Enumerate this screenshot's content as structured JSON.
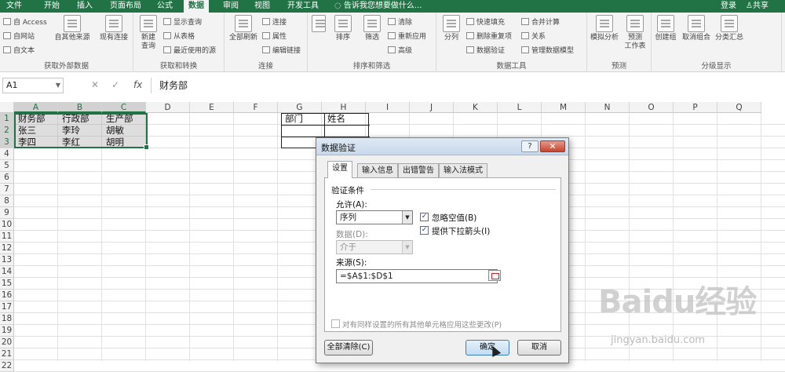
{
  "ribbon_tabs": [
    {
      "label": "文件"
    },
    {
      "label": "开始"
    },
    {
      "label": "插入"
    },
    {
      "label": "页面布局"
    },
    {
      "label": "公式"
    },
    {
      "label": "数据",
      "active": true
    },
    {
      "label": "审阅"
    },
    {
      "label": "视图"
    },
    {
      "label": "开发工具"
    }
  ],
  "tell_me": "告诉我您想要做什么...",
  "login": "登录",
  "share": "共享",
  "groups": {
    "external": {
      "label": "获取外部数据",
      "items": [
        "自 Access",
        "自网站",
        "自文本",
        "自其他来源",
        "现有连接"
      ]
    },
    "transform": {
      "label": "获取和转换",
      "items": [
        "新建",
        "查询",
        "显示查询",
        "从表格",
        "最近使用的源"
      ]
    },
    "connections": {
      "label": "连接",
      "items": [
        "全部刷新",
        "连接",
        "属性",
        "编辑链接"
      ]
    },
    "sort": {
      "label": "排序和筛选",
      "items": [
        "排序",
        "筛选",
        "清除",
        "重新应用",
        "高级"
      ]
    },
    "tools": {
      "label": "数据工具",
      "items": [
        "分列",
        "快速填充",
        "删除重复项",
        "数据验证",
        "合并计算",
        "关系",
        "管理数据模型"
      ]
    },
    "forecast": {
      "label": "预测",
      "items": [
        "模拟分析",
        "预测",
        "工作表"
      ]
    },
    "outline": {
      "label": "分级显示",
      "items": [
        "创建组",
        "取消组合",
        "分类汇总"
      ]
    }
  },
  "formula_bar": {
    "name_box": "A1",
    "content": "财务部"
  },
  "columns": [
    "A",
    "B",
    "C",
    "D",
    "E",
    "F",
    "G",
    "H",
    "I",
    "J",
    "K",
    "L",
    "M",
    "N",
    "O",
    "P",
    "Q"
  ],
  "rows": [
    "1",
    "2",
    "3",
    "4",
    "5",
    "6",
    "7",
    "8",
    "9",
    "10",
    "11",
    "12",
    "13",
    "14",
    "15",
    "16",
    "17",
    "18",
    "19",
    "20",
    "21",
    "22"
  ],
  "cells": {
    "A1": "财务部",
    "B1": "行政部",
    "C1": "生产部",
    "A2": "张三",
    "B2": "李玲",
    "C2": "胡敏",
    "A3": "李四",
    "B3": "李红",
    "C3": "胡明",
    "G1": "部门",
    "H1": "姓名"
  },
  "dialog": {
    "title": "数据验证",
    "help": "?",
    "close": "✕",
    "tabs": [
      "设置",
      "输入信息",
      "出错警告",
      "输入法模式"
    ],
    "active_tab": "设置",
    "section": "验证条件",
    "allow_label": "允许(A):",
    "allow_value": "序列",
    "ignore_blank": {
      "label": "忽略空值(B)",
      "checked": true
    },
    "dropdown_arrow": {
      "label": "提供下拉箭头(I)",
      "checked": true
    },
    "data_label": "数据(D):",
    "data_value": "介于",
    "source_label": "来源(S):",
    "source_value": "=$A$1:$D$1",
    "apply_all": {
      "label": "对有同样设置的所有其他单元格应用这些更改(P)",
      "checked": false
    },
    "clear_all": "全部清除(C)",
    "ok": "确定",
    "cancel": "取消"
  },
  "watermark": {
    "logo": "Baidu经验",
    "url": "jingyan.baidu.com"
  },
  "colors": {
    "ribbon_green": "#217346",
    "selection_border": "#217346",
    "dialog_close": "#c5442f"
  }
}
